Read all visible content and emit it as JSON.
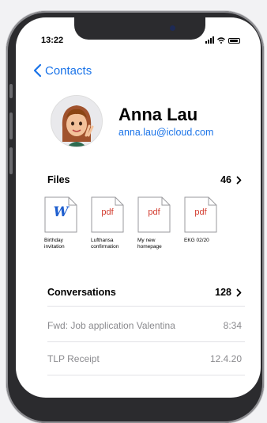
{
  "status_bar": {
    "time": "13:22"
  },
  "nav": {
    "back_label": "Contacts"
  },
  "contact": {
    "name": "Anna Lau",
    "email": "anna.lau@icloud.com"
  },
  "files": {
    "title": "Files",
    "count": "46",
    "items": [
      {
        "type": "word",
        "glyph": "W",
        "label_line1": "Birthday",
        "label_line2": "invitation"
      },
      {
        "type": "pdf",
        "glyph": "pdf",
        "label_line1": "Lufthansa",
        "label_line2": "confirmation"
      },
      {
        "type": "pdf",
        "glyph": "pdf",
        "label_line1": "My new",
        "label_line2": "homepage"
      },
      {
        "type": "pdf",
        "glyph": "pdf",
        "label_line1": "EKG 02/20",
        "label_line2": ""
      }
    ]
  },
  "conversations": {
    "title": "Conversations",
    "count": "128",
    "items": [
      {
        "title": "Fwd: Job application Valentina",
        "time": "8:34"
      },
      {
        "title": "TLP Receipt",
        "time": "12.4.20"
      }
    ]
  },
  "colors": {
    "accent": "#1a73e8",
    "pdf_red": "#d23b2e",
    "word_blue": "#1f5fcf"
  }
}
